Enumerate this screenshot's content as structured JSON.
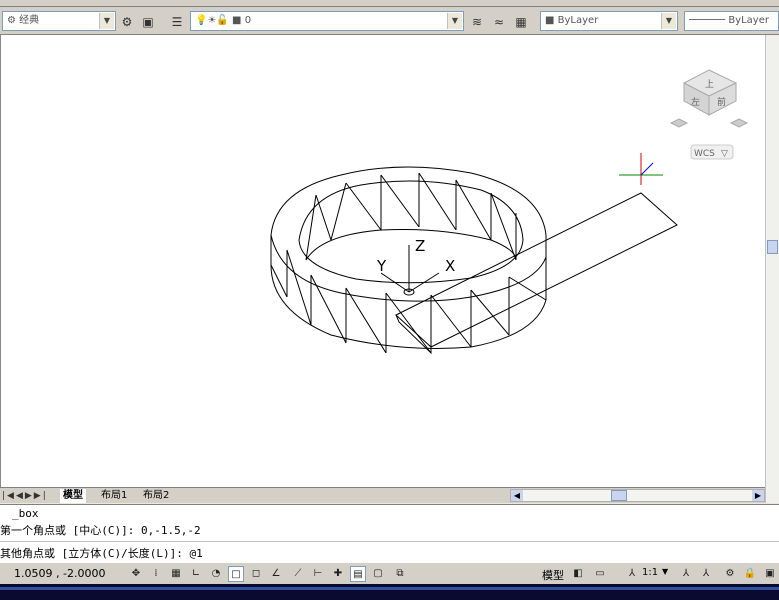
{
  "toolbar": {
    "workspace_value": "经典",
    "layer_value": "0",
    "color_value": "ByLayer",
    "linetype_value": "ByLayer"
  },
  "viewcube": {
    "face_top": "上",
    "face_left": "左",
    "face_front": "前",
    "wcs_label": "WCS"
  },
  "ucs": {
    "x": "X",
    "y": "Y",
    "z": "Z"
  },
  "layout_tabs": [
    {
      "label": "模型"
    },
    {
      "label": "布局1"
    },
    {
      "label": "布局2"
    }
  ],
  "command": {
    "lines": [
      "_box",
      "第一个角点或 [中心(C)]: 0,-1.5,-2",
      "其他角点或 [立方体(C)/长度(L)]: @1"
    ]
  },
  "status": {
    "coordinates": "1.0509 , -2.0000",
    "model_label": "模型",
    "scale_label": "1:1"
  }
}
